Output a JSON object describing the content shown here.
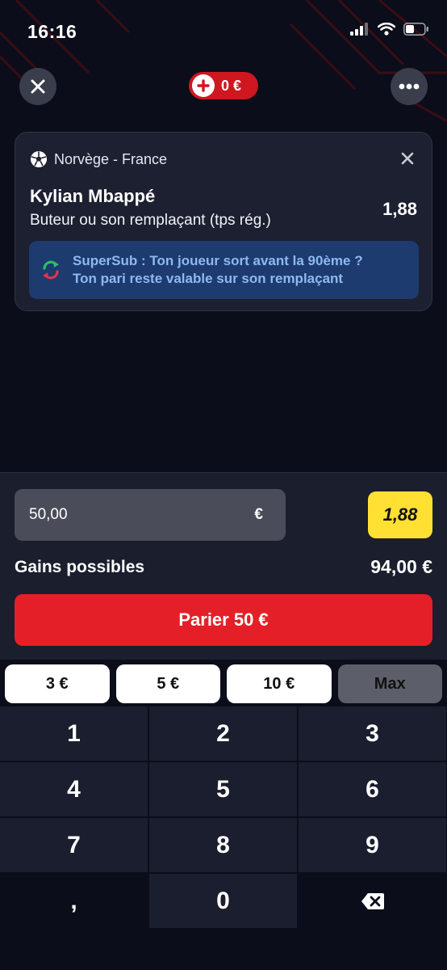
{
  "status": {
    "time": "16:16"
  },
  "header": {
    "balance": "0 €"
  },
  "bet": {
    "match": "Norvège - France",
    "player": "Kylian Mbappé",
    "market": "Buteur ou son remplaçant (tps rég.)",
    "odd": "1,88",
    "supersub_line1": "SuperSub : Ton joueur sort avant la 90ème ?",
    "supersub_line2": "Ton pari reste valable sur son remplaçant"
  },
  "stake": {
    "value": "50,00",
    "currency": "€",
    "odd": "1,88",
    "gains_label": "Gains possibles",
    "gains_value": "94,00 €",
    "bet_button": "Parier 50 €"
  },
  "quick_amounts": [
    "3 €",
    "5 €",
    "10 €",
    "Max"
  ],
  "keys": [
    "1",
    "2",
    "3",
    "4",
    "5",
    "6",
    "7",
    "8",
    "9",
    ",",
    "0"
  ],
  "colors": {
    "accent": "#e51f27",
    "odd_badge": "#ffe033",
    "supersub_bg": "#1d3b6e"
  }
}
